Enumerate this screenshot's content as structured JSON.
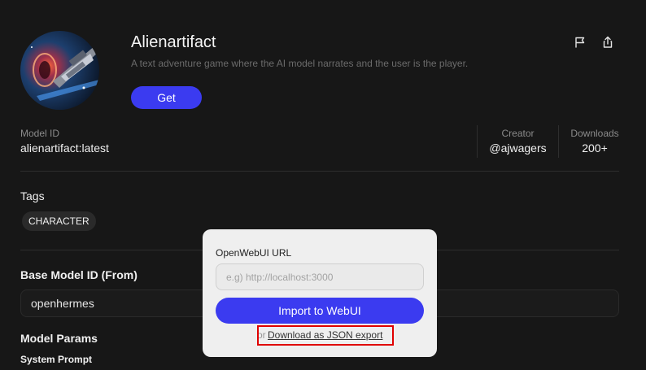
{
  "model": {
    "name": "Alienartifact",
    "description": "A text adventure game where the AI model narrates and the user is the player.",
    "get_label": "Get",
    "avatar_icon": "model-avatar-spaceship"
  },
  "header_actions": {
    "flag_icon": "flag-icon",
    "share_icon": "share-icon"
  },
  "meta": {
    "model_id_label": "Model ID",
    "model_id_value": "alienartifact:latest",
    "creator_label": "Creator",
    "creator_value": "@ajwagers",
    "downloads_label": "Downloads",
    "downloads_value": "200+"
  },
  "tags": {
    "heading": "Tags",
    "items": [
      "CHARACTER"
    ]
  },
  "base_model": {
    "heading": "Base Model ID (From)",
    "value": "openhermes"
  },
  "params": {
    "heading": "Model Params",
    "system_prompt_label": "System Prompt"
  },
  "popup": {
    "url_label": "OpenWebUI URL",
    "url_placeholder": "e.g) http://localhost:3000",
    "url_value": "",
    "import_label": "Import to WebUI",
    "or_text": "or",
    "json_link": "Download as JSON export"
  },
  "colors": {
    "accent": "#3b3bf0",
    "background": "#171717",
    "highlight": "#e00000"
  }
}
